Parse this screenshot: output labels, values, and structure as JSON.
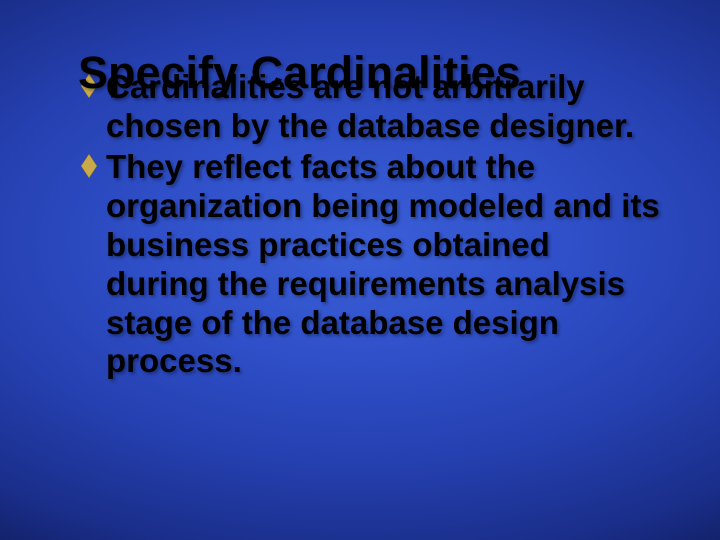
{
  "slide": {
    "title": "Specify Cardinalities",
    "bullets": [
      "Cardinalities are not arbitrarily chosen by the database designer.",
      "They reflect facts about the organization being modeled and its business practices obtained during the requirements analysis stage of the database design process."
    ]
  }
}
